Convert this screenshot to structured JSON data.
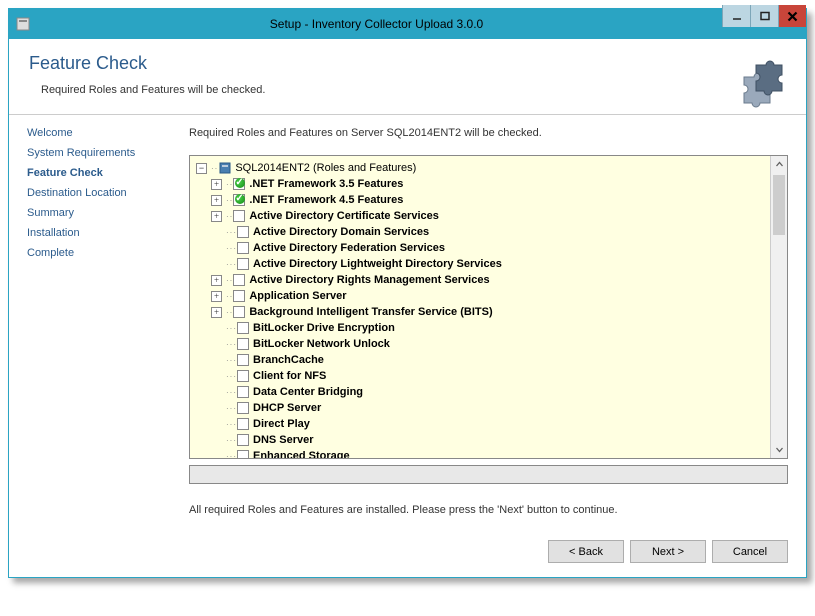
{
  "window": {
    "title": "Setup - Inventory Collector Upload 3.0.0"
  },
  "header": {
    "title": "Feature Check",
    "subtitle": "Required Roles and Features will be checked."
  },
  "sidebar": {
    "items": [
      {
        "label": "Welcome"
      },
      {
        "label": "System Requirements"
      },
      {
        "label": "Feature Check"
      },
      {
        "label": "Destination Location"
      },
      {
        "label": "Summary"
      },
      {
        "label": "Installation"
      },
      {
        "label": "Complete"
      }
    ],
    "current_index": 2
  },
  "main": {
    "description": "Required Roles and Features on Server SQL2014ENT2 will be checked.",
    "status": "All required Roles and Features are installed. Please press the 'Next' button to continue."
  },
  "tree": {
    "root": "SQL2014ENT2 (Roles and Features)",
    "items": [
      {
        "label": ".NET Framework 3.5 Features",
        "checked": true,
        "expandable": true
      },
      {
        "label": ".NET Framework 4.5 Features",
        "checked": true,
        "expandable": true
      },
      {
        "label": "Active Directory Certificate Services",
        "checked": false,
        "expandable": true
      },
      {
        "label": "Active Directory Domain Services",
        "checked": false,
        "expandable": false
      },
      {
        "label": "Active Directory Federation Services",
        "checked": false,
        "expandable": false
      },
      {
        "label": "Active Directory Lightweight Directory Services",
        "checked": false,
        "expandable": false
      },
      {
        "label": "Active Directory Rights Management Services",
        "checked": false,
        "expandable": true
      },
      {
        "label": "Application Server",
        "checked": false,
        "expandable": true
      },
      {
        "label": "Background Intelligent Transfer Service (BITS)",
        "checked": false,
        "expandable": true
      },
      {
        "label": "BitLocker Drive Encryption",
        "checked": false,
        "expandable": false
      },
      {
        "label": "BitLocker Network Unlock",
        "checked": false,
        "expandable": false
      },
      {
        "label": "BranchCache",
        "checked": false,
        "expandable": false
      },
      {
        "label": "Client for NFS",
        "checked": false,
        "expandable": false
      },
      {
        "label": "Data Center Bridging",
        "checked": false,
        "expandable": false
      },
      {
        "label": "DHCP Server",
        "checked": false,
        "expandable": false
      },
      {
        "label": "Direct Play",
        "checked": false,
        "expandable": false
      },
      {
        "label": "DNS Server",
        "checked": false,
        "expandable": false
      },
      {
        "label": "Enhanced Storage",
        "checked": false,
        "expandable": false
      }
    ]
  },
  "buttons": {
    "back": "< Back",
    "next": "Next >",
    "cancel": "Cancel"
  }
}
